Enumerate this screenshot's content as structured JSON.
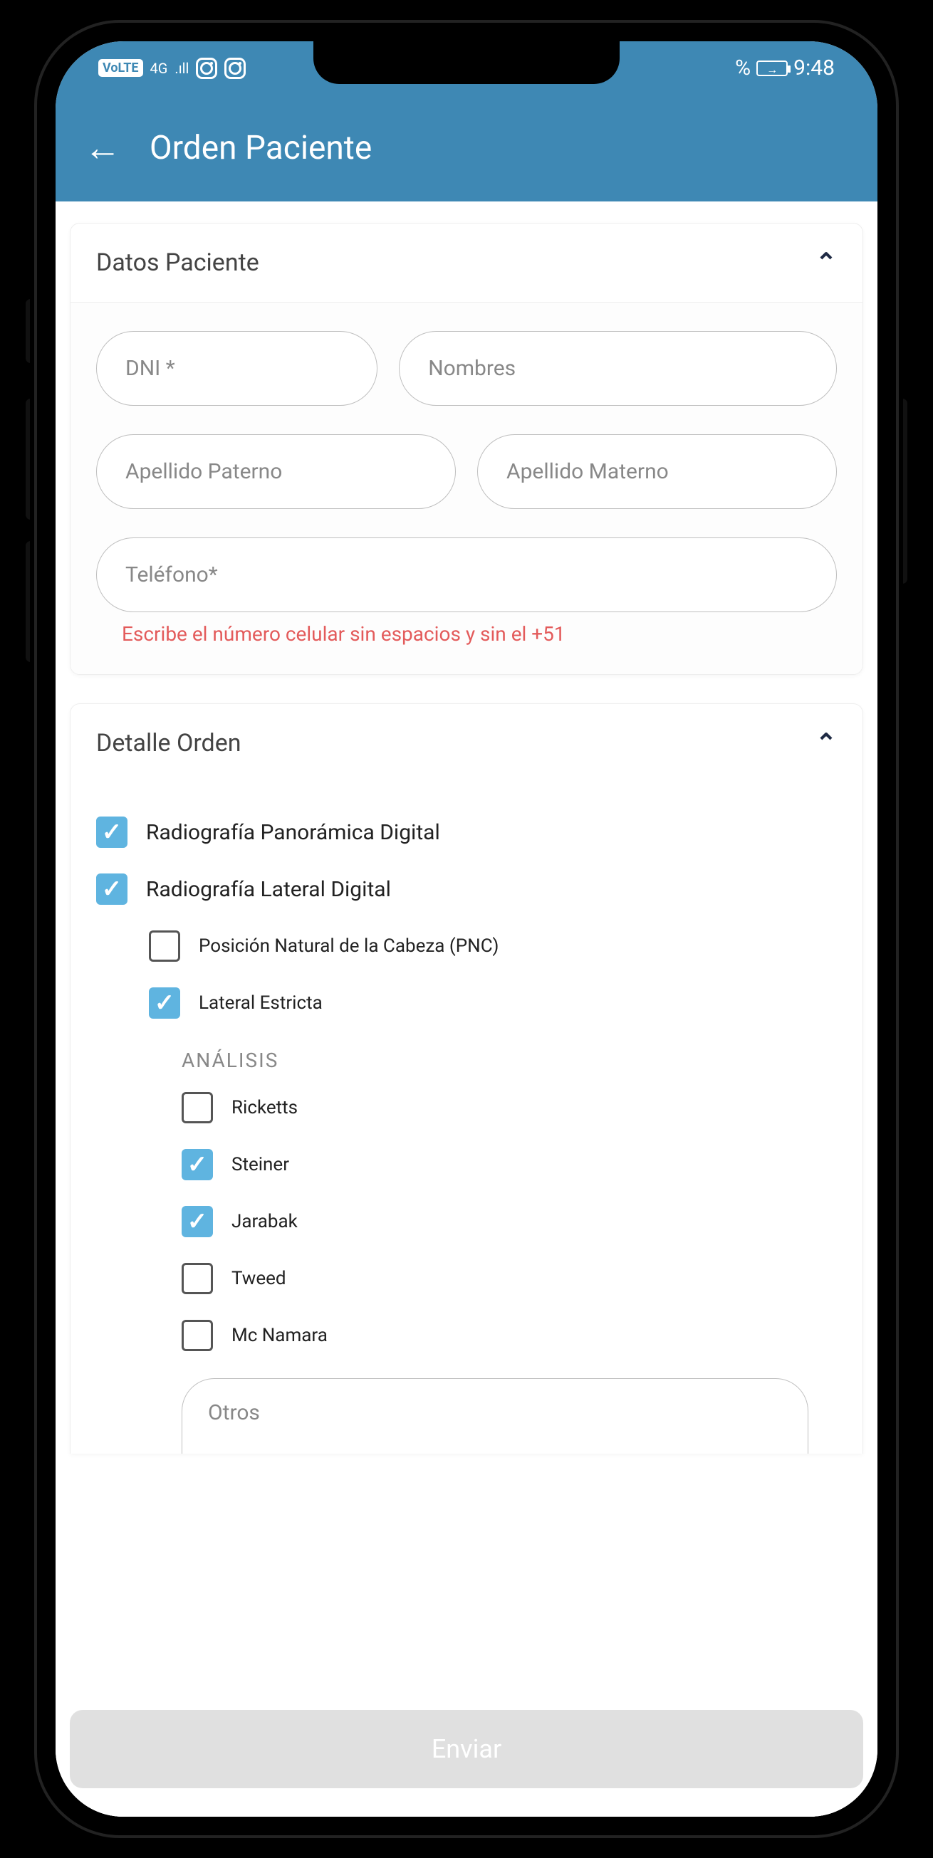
{
  "status": {
    "volte": "VoLTE",
    "net": "4G",
    "percent": "%",
    "time": "9:48"
  },
  "appbar": {
    "title": "Orden Paciente"
  },
  "patient": {
    "section_title": "Datos Paciente",
    "dni_placeholder": "DNI *",
    "nombres_placeholder": "Nombres",
    "ap_paterno_placeholder": "Apellido Paterno",
    "ap_materno_placeholder": "Apellido Materno",
    "telefono_placeholder": "Teléfono*",
    "telefono_hint": "Escribe el número celular sin espacios y sin el +51"
  },
  "order": {
    "section_title": "Detalle Orden",
    "items": {
      "panoramica": "Radiografía Panorámica Digital",
      "lateral": "Radiografía Lateral Digital",
      "pnc": "Posición Natural de la Cabeza (PNC)",
      "estricta": "Lateral Estricta",
      "analisis_label": "ANÁLISIS",
      "ricketts": "Ricketts",
      "steiner": "Steiner",
      "jarabak": "Jarabak",
      "tweed": "Tweed",
      "mcnamara": "Mc Namara",
      "otros_placeholder": "Otros"
    }
  },
  "submit": {
    "label": "Enviar"
  }
}
